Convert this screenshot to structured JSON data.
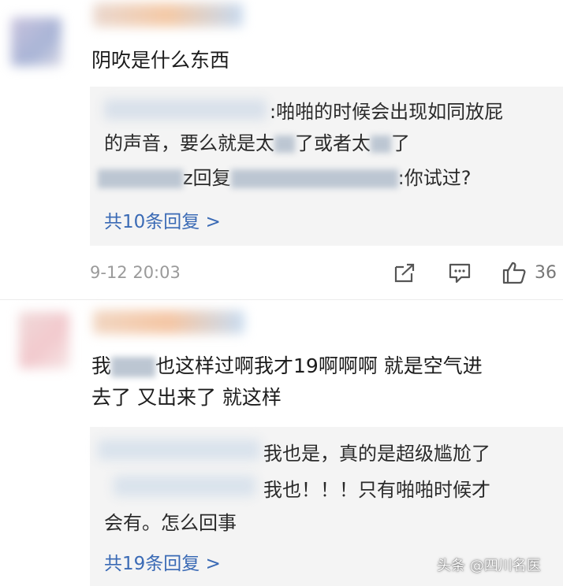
{
  "comment1": {
    "text": "阴吹是什么东西",
    "replies": [
      {
        "text_a": ":啪啪的时候会出现如同放屁",
        "text_b": "的声音，要么就是太",
        "text_c": "了或者太",
        "text_d": "了"
      },
      {
        "mid": "z回复",
        "tail": ":你试过?"
      }
    ],
    "more_replies": "共10条回复 >",
    "timestamp": "9-12 20:03",
    "like_count": "36"
  },
  "comment2": {
    "text_start": "我",
    "text_rest": "也这样过啊我才19啊啊啊 就是空气进",
    "text_line2": "去了 又出来了 就这样",
    "replies": [
      {
        "text": "我也是，真的是超级尴尬了"
      },
      {
        "text_a": "我也！！！只有啪啪时候才",
        "text_b": "会有。怎么回事"
      }
    ],
    "more_replies": "共19条回复 >"
  },
  "watermark": "头条 @四川名医",
  "icons": [
    "share-icon",
    "comment-icon",
    "thumbs-up-icon"
  ]
}
